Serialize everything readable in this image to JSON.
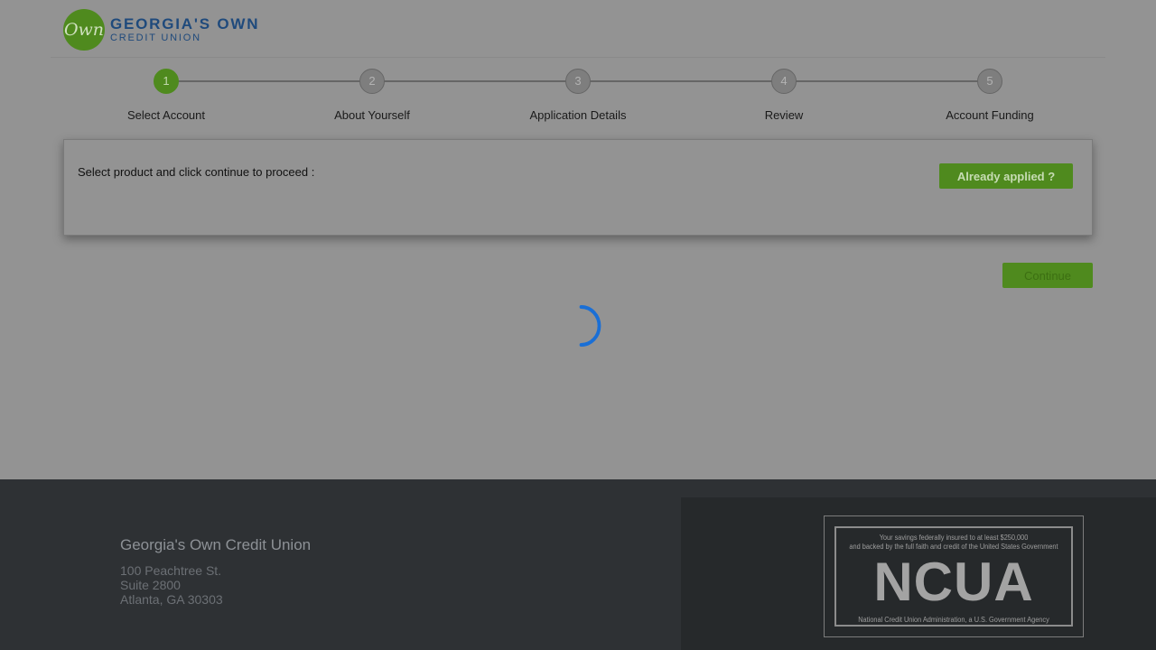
{
  "header": {
    "logo_mark": "Own",
    "logo_line1": "GEORGIA'S OWN",
    "logo_line2": "CREDIT UNION"
  },
  "stepper": {
    "steps": [
      {
        "number": "1",
        "label": "Select Account",
        "active": true
      },
      {
        "number": "2",
        "label": "About Yourself",
        "active": false
      },
      {
        "number": "3",
        "label": "Application Details",
        "active": false
      },
      {
        "number": "4",
        "label": "Review",
        "active": false
      },
      {
        "number": "5",
        "label": "Account Funding",
        "active": false
      }
    ]
  },
  "panel": {
    "instruction": "Select product and click continue to proceed :",
    "already_applied_label": "Already applied ?"
  },
  "continue_label": "Continue",
  "footer": {
    "cu_name": "Georgia's Own Credit Union",
    "address_line1": "100 Peachtree St.",
    "address_line2": "Suite 2800",
    "address_line3": "Atlanta, GA 30303",
    "ncua_line1": "Your savings federally insured to at least $250,000",
    "ncua_line2": "and backed by the full faith and credit of the United States Government",
    "ncua_big": "NCUA",
    "ncua_bottom": "National Credit Union Administration, a U.S. Government Agency"
  },
  "colors": {
    "brand_green": "#4f8a1e",
    "brand_blue": "#1f4a7c",
    "spinner": "#1a6fd6"
  },
  "icons": {
    "spinner": "loading-spinner-icon"
  }
}
